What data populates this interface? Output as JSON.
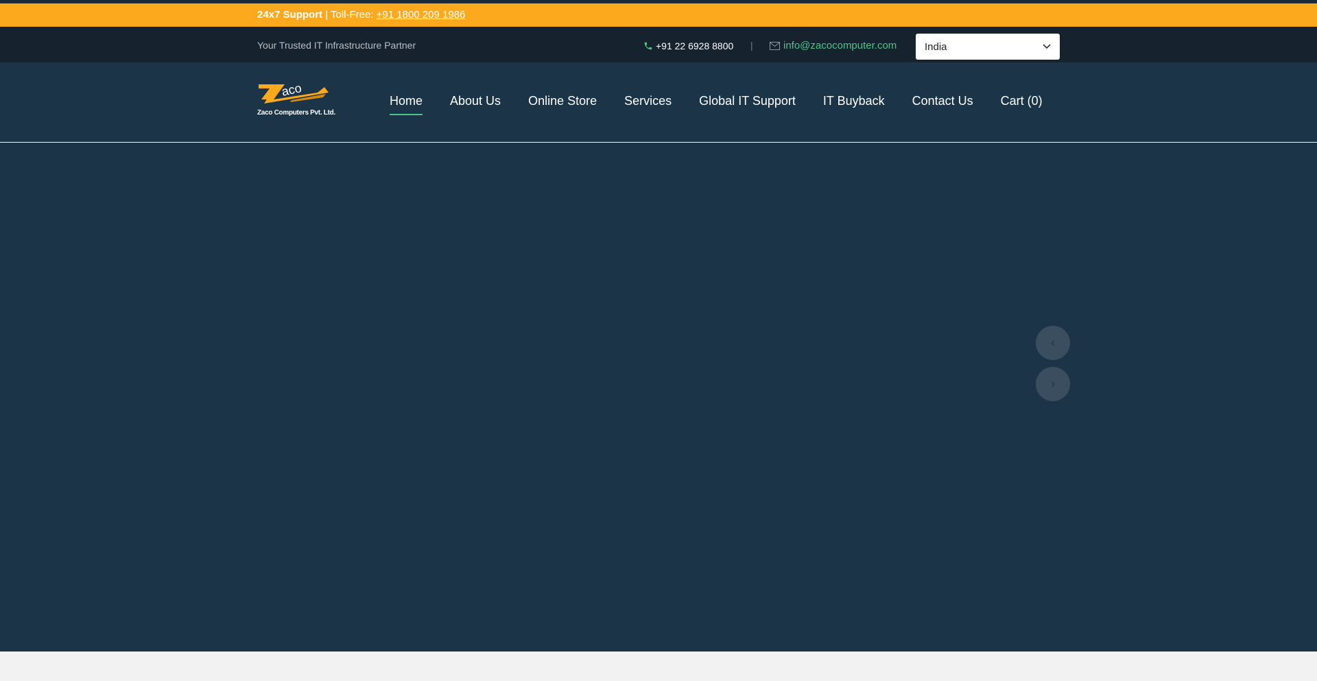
{
  "support_bar": {
    "label": "24x7 Support",
    "separator_text": " | Toll-Free: ",
    "toll_free": "+91 1800 209 1986"
  },
  "info_bar": {
    "tagline": "Your Trusted IT Infrastructure Partner",
    "phone": "+91 22 6928 8800",
    "separator": "|",
    "email": "info@zacocomputer.com",
    "country_selected": "India"
  },
  "logo": {
    "mark_text": "aco",
    "company_name": "Zaco Computers Pvt. Ltd."
  },
  "nav": {
    "items": [
      {
        "label": "Home",
        "active": true
      },
      {
        "label": "About Us"
      },
      {
        "label": "Online Store"
      },
      {
        "label": "Services"
      },
      {
        "label": "Global IT Support"
      },
      {
        "label": "IT Buyback"
      },
      {
        "label": "Contact Us"
      },
      {
        "label": "Cart (0)"
      }
    ]
  },
  "carousel": {
    "prev_icon": "‹",
    "next_icon": "›"
  },
  "colors": {
    "accent_orange": "#fca91e",
    "accent_green": "#4cc489",
    "nav_bg": "#1b3448",
    "topbar_bg": "#16222e"
  }
}
